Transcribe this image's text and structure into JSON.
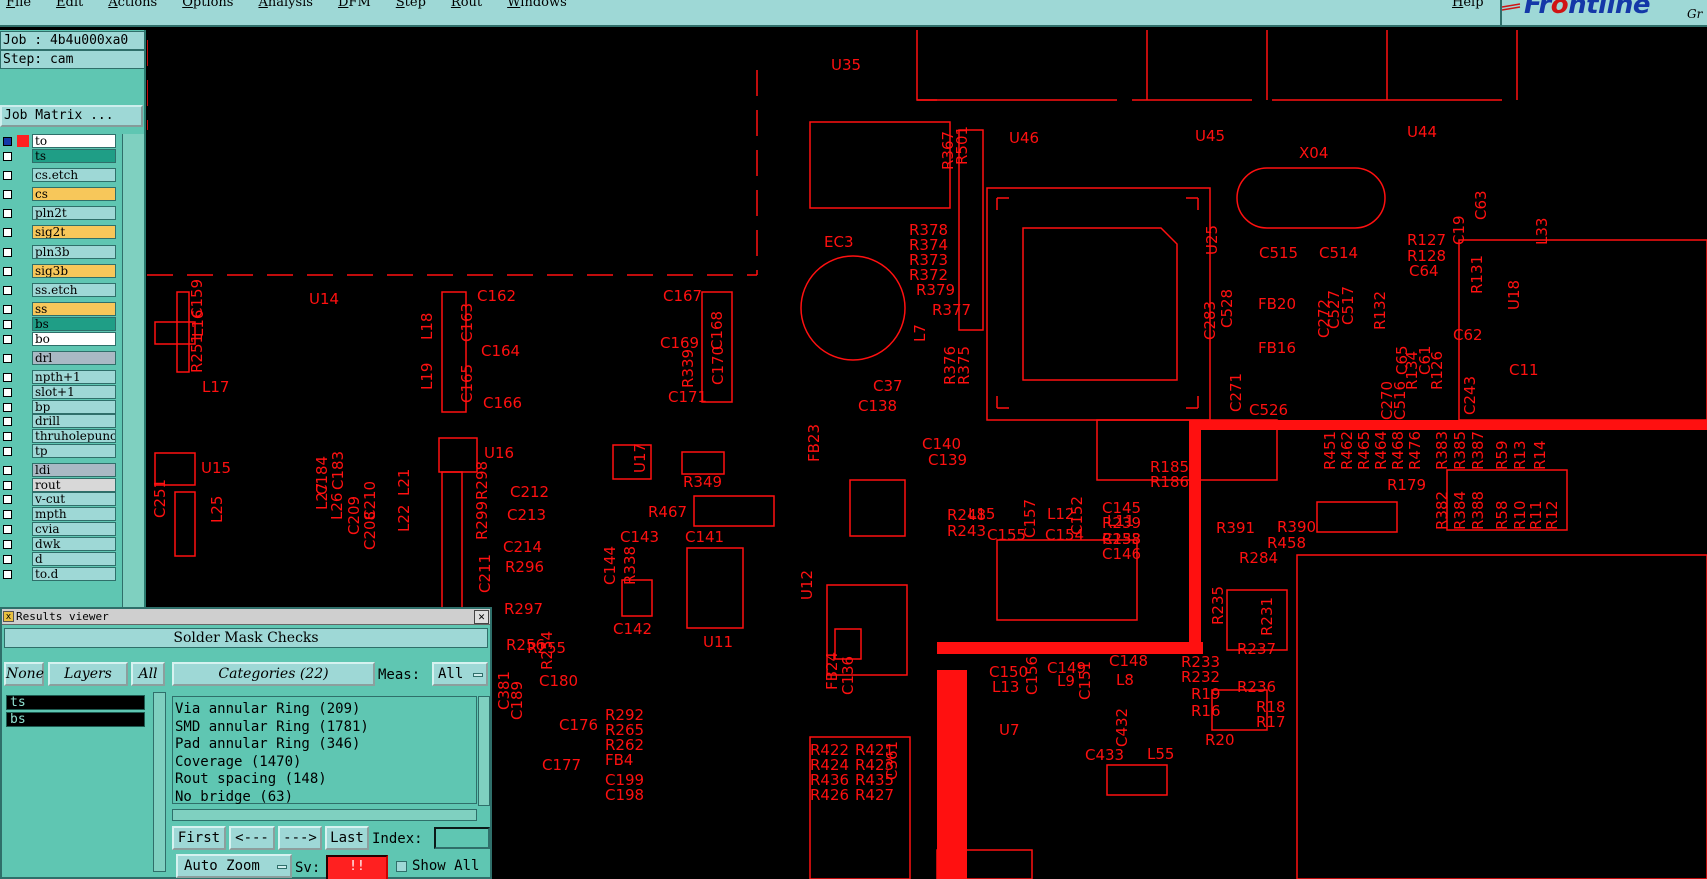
{
  "menubar": {
    "items": [
      "File",
      "Edit",
      "Actions",
      "Options",
      "Analysis",
      "DFM",
      "Step",
      "Rout",
      "Windows"
    ],
    "help": "Help"
  },
  "brand": {
    "logo": "Frontline",
    "corner_text": "Gr",
    "logo_color": "#1438a8",
    "accent_color": "#d01414"
  },
  "job": {
    "job_label": "Job : 4b4u000xa0",
    "step_label": "Step: cam",
    "matrix_button": "Job Matrix ..."
  },
  "layers": [
    {
      "name": "to",
      "bg": "#ffffff"
    },
    {
      "name": "ts",
      "bg": "#1f9e86"
    },
    {
      "name": "cs.etch",
      "bg": "#9ed8d6"
    },
    {
      "name": "cs",
      "bg": "#f7c75a"
    },
    {
      "name": "pln2t",
      "bg": "#9ed8d6"
    },
    {
      "name": "sig2t",
      "bg": "#f7c75a"
    },
    {
      "name": "pln3b",
      "bg": "#9ed8d6"
    },
    {
      "name": "sig3b",
      "bg": "#f7c75a"
    },
    {
      "name": "ss.etch",
      "bg": "#9ed8d6"
    },
    {
      "name": "ss",
      "bg": "#f7c75a"
    },
    {
      "name": "bs",
      "bg": "#1f9e86"
    },
    {
      "name": "bo",
      "bg": "#ffffff"
    },
    {
      "name": "drl",
      "bg": "#a9b9c4"
    },
    {
      "name": "npth+1",
      "bg": "#9ed8d6"
    },
    {
      "name": "slot+1",
      "bg": "#9ed8d6"
    },
    {
      "name": "bp",
      "bg": "#9ed8d6"
    },
    {
      "name": "drill",
      "bg": "#9ed8d6"
    },
    {
      "name": "thruholepunch",
      "bg": "#9ed8d6"
    },
    {
      "name": "tp",
      "bg": "#9ed8d6"
    },
    {
      "name": "ldi",
      "bg": "#a9b9c4"
    },
    {
      "name": "rout",
      "bg": "#d8d8d8"
    },
    {
      "name": "v-cut",
      "bg": "#9ed8d6"
    },
    {
      "name": "mpth",
      "bg": "#9ed8d6"
    },
    {
      "name": "cvia",
      "bg": "#9ed8d6"
    },
    {
      "name": "dwk",
      "bg": "#9ed8d6"
    },
    {
      "name": "d",
      "bg": "#9ed8d6"
    },
    {
      "name": "to.d",
      "bg": "#9ed8d6"
    }
  ],
  "results_viewer": {
    "title": "Results viewer",
    "heading": "Solder Mask Checks",
    "none_btn": "None",
    "layers_btn": "Layers",
    "all_btn": "All",
    "categories_btn": "Categories (22)",
    "meas_label": "Meas:",
    "meas_value": "All",
    "selected_layers": [
      "ts",
      "bs"
    ],
    "categories": [
      "Via annular Ring (209)",
      "SMD annular Ring (1781)",
      "Pad annular Ring (346)",
      "Coverage (1470)",
      "Rout spacing (148)",
      "No bridge (63)"
    ],
    "first_btn": "First",
    "prev_btn": "<---",
    "next_btn": "--->",
    "last_btn": "Last",
    "index_label": "Index:",
    "zoom_value": "Auto Zoom",
    "sv_label": "Sv:",
    "sv_value": "!!",
    "showall_label": "Show All"
  },
  "board": {
    "trace_color": "#ff1010",
    "refdes": [
      "U35",
      "U46",
      "U45",
      "U44",
      "X04",
      "U14",
      "U15",
      "U16",
      "U17",
      "U11",
      "U12",
      "U7",
      "EC3",
      "L7",
      "U25",
      "C159",
      "L16",
      "R251",
      "L17",
      "C162",
      "C163",
      "L18",
      "C164",
      "C165",
      "L19",
      "C166",
      "C167",
      "C168",
      "C169",
      "C170",
      "C171",
      "R339",
      "C37",
      "C138",
      "C139",
      "C140",
      "FB23",
      "R349",
      "R467",
      "C141",
      "C143",
      "C144",
      "R338",
      "C142",
      "C212",
      "C213",
      "C214",
      "C211",
      "R296",
      "R297",
      "R298",
      "R299",
      "R256",
      "R255",
      "C180",
      "R292",
      "R265",
      "R262",
      "FB4",
      "C199",
      "C198",
      "C177",
      "C515",
      "C514",
      "C528",
      "FB20",
      "FB16",
      "C271",
      "C526",
      "C283",
      "C272",
      "C527",
      "C517",
      "R127",
      "R128",
      "C64",
      "R131",
      "C19",
      "C63",
      "L33",
      "R132",
      "C65",
      "R134",
      "C61",
      "R126",
      "C62",
      "C270",
      "C516",
      "C243",
      "U18",
      "C11",
      "R185",
      "R186",
      "C145",
      "R239",
      "R238",
      "C146",
      "L15",
      "C157",
      "L12",
      "C152",
      "L11",
      "C153",
      "C155",
      "C154",
      "R248",
      "R243",
      "R391",
      "R390",
      "R458",
      "R284",
      "R235",
      "R231",
      "R237",
      "R233",
      "R232",
      "R236",
      "R19",
      "R16",
      "R18",
      "R17",
      "R20",
      "R179",
      "C150",
      "C156",
      "C149",
      "C148",
      "L13",
      "L9",
      "C151",
      "L8",
      "C432",
      "C433",
      "L55",
      "FB24",
      "C136",
      "R378",
      "R374",
      "R373",
      "R372",
      "R379",
      "R377",
      "R376",
      "R375",
      "R367",
      "R501",
      "R422",
      "R421",
      "R424",
      "R423",
      "R436",
      "R435",
      "R426",
      "R427",
      "C361",
      "R451",
      "R462",
      "R465",
      "R464",
      "R468",
      "R476",
      "R383",
      "R385",
      "R387",
      "R59",
      "R13",
      "R14",
      "R58",
      "R10",
      "R11",
      "R12",
      "R382",
      "R384",
      "R388",
      "C251",
      "L25",
      "L21",
      "L22",
      "L27",
      "C184",
      "C183",
      "L26",
      "C210",
      "C209",
      "C208",
      "L4",
      "C381",
      "C189",
      "R254",
      "C176"
    ]
  }
}
